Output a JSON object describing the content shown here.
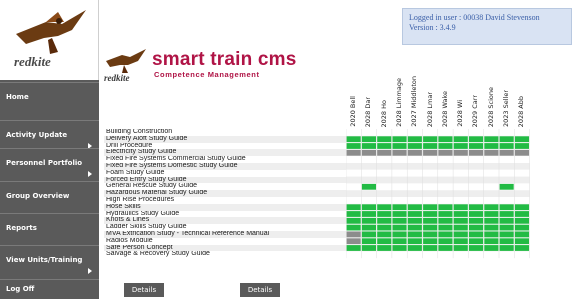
{
  "login": {
    "user_line": "Logged in user :  00038 David Stevenson",
    "version_line": "Version : 3.4.9"
  },
  "logo": {
    "text": "redkite"
  },
  "brand": {
    "title": "smart train cms",
    "subtitle": "Competence Management",
    "subtitle_prefix": "redkite"
  },
  "nav": [
    {
      "label": "Home",
      "arrow": false
    },
    {
      "label": "Activity Update",
      "arrow": true
    },
    {
      "label": "Personnel Portfolio",
      "arrow": true
    },
    {
      "label": "Group Overview",
      "arrow": false
    },
    {
      "label": "Reports",
      "arrow": false
    },
    {
      "label": "View Units/Training",
      "arrow": true
    },
    {
      "label": "Log Off",
      "arrow": false
    }
  ],
  "people": [
    "2020 Bell",
    "2028 Dar",
    "2028 Ho",
    "2028 Limmage",
    "2027 Middleton",
    "2028 Lmar",
    "2028 Wake",
    "2028 Wi",
    "2029 Carr",
    "2028 Scione",
    "2023 Seller",
    "2028 Abb"
  ],
  "rows": [
    {
      "name": "Building Construction",
      "cells": "000000000000"
    },
    {
      "name": "Delivery Aloft Study Guide",
      "cells": "111111111111"
    },
    {
      "name": "Drill Procedure",
      "cells": "111111111111"
    },
    {
      "name": "Electricity Study Guide",
      "cells": "222222222222"
    },
    {
      "name": "Fixed Fire Systems Commercial Study Guide",
      "cells": "000000000000"
    },
    {
      "name": "Fixed Fire Systems Domestic Study Guide",
      "cells": "000000000000"
    },
    {
      "name": "Foam Study Guide",
      "cells": "000000000000"
    },
    {
      "name": "Forced Entry Study Guide",
      "cells": "000000000000"
    },
    {
      "name": "General Rescue Study Guide",
      "cells": "010000000010"
    },
    {
      "name": "Hazardous Material Study Guide",
      "cells": "000000000000"
    },
    {
      "name": "High Rise Procedures",
      "cells": "000000000000"
    },
    {
      "name": "Hose Skills",
      "cells": "111111111111"
    },
    {
      "name": "Hydraulics Study Guide",
      "cells": "111111111111"
    },
    {
      "name": "Knots & Lines",
      "cells": "111111111111"
    },
    {
      "name": "Ladder Skills Study Guide",
      "cells": "111111111111"
    },
    {
      "name": "MVA Extrication Study - Technical Reference Manual",
      "cells": "211111111111"
    },
    {
      "name": "Radios Module",
      "cells": "211111111111"
    },
    {
      "name": "Safe Person Concept",
      "cells": "111111111111"
    },
    {
      "name": "Salvage & Recovery Study Guide",
      "cells": "000000000000"
    }
  ],
  "colors": {
    "green": "#22bb44",
    "gray": "#8c8c8c",
    "accent": "#b01446",
    "sidebar": "#5a5a5a"
  },
  "buttons": {
    "details_1": "Details",
    "details_2": "Details"
  }
}
